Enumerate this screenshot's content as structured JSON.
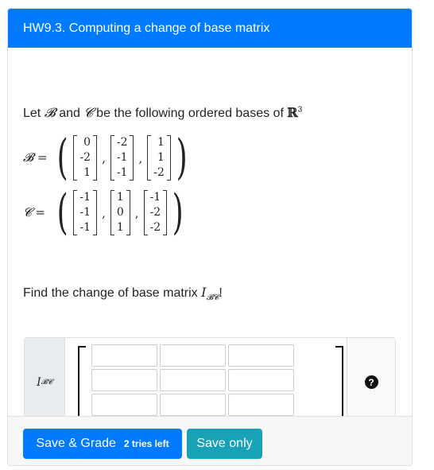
{
  "header": {
    "title": "HW9.3. Computing a change of base matrix"
  },
  "question": {
    "intro_pre": "Let ",
    "sym_b": "𝓑",
    "intro_and": " and ",
    "sym_c": "𝓒",
    "intro_post": " be the following ordered bases of ",
    "space": "ℝ",
    "space_exp": "3",
    "basis_b_label": "𝓑 =",
    "basis_b": [
      [
        "0",
        "-2",
        "1"
      ],
      [
        "-2",
        "-1",
        "-1"
      ],
      [
        "1",
        "1",
        "-2"
      ]
    ],
    "basis_c_label": "𝓒 =",
    "basis_c": [
      [
        "-1",
        "-1",
        "-1"
      ],
      [
        "1",
        "0",
        "1"
      ],
      [
        "-1",
        "-2",
        "-2"
      ]
    ],
    "prompt_pre": "Find the change of base matrix ",
    "prompt_sym": "I",
    "prompt_sub": "𝓑𝓒",
    "prompt_post": "!"
  },
  "answer": {
    "label": "I",
    "label_sub": "𝓑𝓒",
    "rows": 3,
    "cols": 3,
    "help_icon": "question-circle-icon"
  },
  "footer": {
    "save_grade_label": "Save & Grade",
    "tries_left": "2 tries left",
    "save_only_label": "Save only"
  }
}
